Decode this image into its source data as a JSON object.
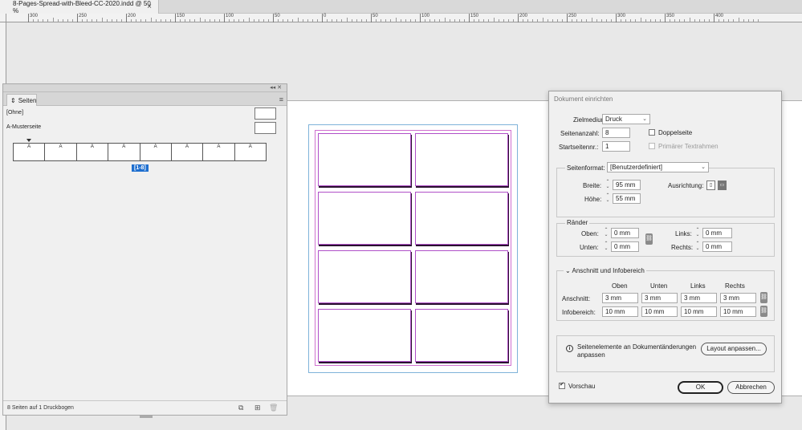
{
  "document_tab": {
    "title": "8-Pages-Spread-with-Bleed-CC-2020.indd @ 50 %",
    "close": "×"
  },
  "ruler": {
    "labels": [
      "300",
      "250",
      "200",
      "150",
      "100",
      "50",
      "0",
      "50",
      "100",
      "150",
      "200",
      "250",
      "300",
      "350",
      "400"
    ]
  },
  "pages_panel": {
    "tab_label": "Seiten",
    "masters": [
      {
        "label": "[Ohne]"
      },
      {
        "label": "A-Musterseite"
      }
    ],
    "spread_pages": [
      "A",
      "A",
      "A",
      "A",
      "A",
      "A",
      "A",
      "A"
    ],
    "spread_label": "[1-8]",
    "status": "8 Seiten auf 1 Druckbogen"
  },
  "dialog": {
    "title": "Dokument einrichten",
    "zielmedium": {
      "label": "Zielmedium:",
      "value": "Druck"
    },
    "seitenanzahl": {
      "label": "Seitenanzahl:",
      "value": "8"
    },
    "startseite": {
      "label": "Startseitennr.:",
      "value": "1"
    },
    "doppelseite": {
      "label": "Doppelseite",
      "checked": false
    },
    "textrahmen": {
      "label": "Primärer Textrahmen",
      "checked": false
    },
    "seitenformat": {
      "label": "Seitenformat:",
      "value": "[Benutzerdefiniert]",
      "breite_label": "Breite:",
      "breite": "95 mm",
      "hoehe_label": "Höhe:",
      "hoehe": "55 mm",
      "ausrichtung_label": "Ausrichtung:"
    },
    "raender": {
      "title": "Ränder",
      "oben_label": "Oben:",
      "oben": "0 mm",
      "unten_label": "Unten:",
      "unten": "0 mm",
      "links_label": "Links:",
      "links": "0 mm",
      "rechts_label": "Rechts:",
      "rechts": "0 mm"
    },
    "anschnitt": {
      "title": "Anschnitt und Infobereich",
      "col_oben": "Oben",
      "col_unten": "Unten",
      "col_links": "Links",
      "col_rechts": "Rechts",
      "anschnitt_label": "Anschnitt:",
      "anschnitt_values": [
        "3 mm",
        "3 mm",
        "3 mm",
        "3 mm"
      ],
      "info_label": "Infobereich:",
      "info_values": [
        "10 mm",
        "10 mm",
        "10 mm",
        "10 mm"
      ]
    },
    "info_text_1": "Seitenelemente an Dokumentänderungen",
    "info_text_2": "anpassen",
    "layout_button": "Layout anpassen...",
    "vorschau": {
      "label": "Vorschau",
      "checked": true
    },
    "ok_button": "OK",
    "cancel_button": "Abbrechen"
  }
}
